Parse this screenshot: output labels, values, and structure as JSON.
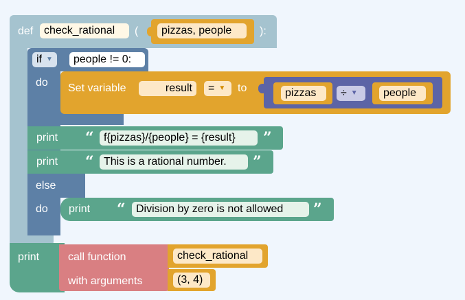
{
  "def_block": {
    "keyword": "def",
    "function_name": "check_rational",
    "open_paren": "(",
    "params": "pizzas, people",
    "close": "):"
  },
  "if_block": {
    "keyword": "if",
    "condition": "people != 0:",
    "do_label": "do",
    "else_label": "else",
    "else_do_label": "do"
  },
  "set_block": {
    "label": "Set variable",
    "variable": "result",
    "operator": "=",
    "to_label": "to"
  },
  "division_block": {
    "left": "pizzas",
    "operator": "÷",
    "right": "people"
  },
  "prints": [
    {
      "label": "print",
      "text": "f{pizzas}/{people} = {result}"
    },
    {
      "label": "print",
      "text": "This is a rational number."
    },
    {
      "label": "print",
      "text": "Division by zero is not allowed"
    }
  ],
  "outer_print": {
    "label": "print",
    "call_label": "call function",
    "function_name": "check_rational",
    "args_label": "with arguments",
    "args": "(3, 4)"
  },
  "quote_open": "“",
  "quote_close": "”",
  "colors": {
    "def_block": "#a5c3cf",
    "if_block": "#5d80a6",
    "set_block": "#e2a42d",
    "division_block": "#5c64a6",
    "print_block": "#5ba58c",
    "call_block": "#d97f82",
    "workspace": "#f0f6fd"
  }
}
